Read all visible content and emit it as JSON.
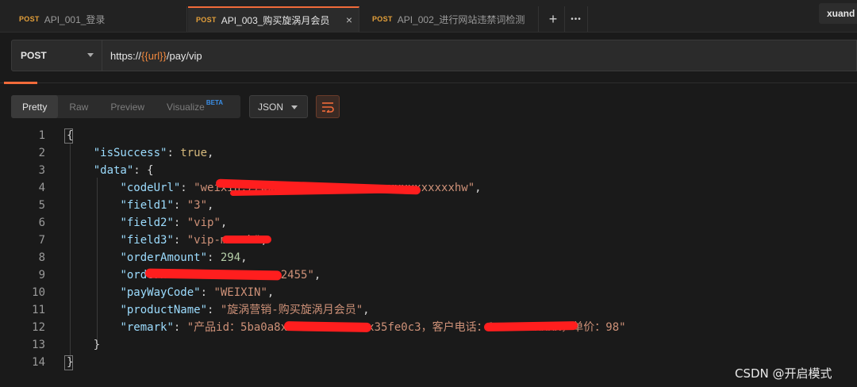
{
  "tabs": [
    {
      "method": "POST",
      "name": "API_001_登录",
      "active": false
    },
    {
      "method": "POST",
      "name": "API_003_购买旋涡月会员",
      "active": true
    },
    {
      "method": "POST",
      "name": "API_002_进行网站违禁词检测",
      "active": false
    }
  ],
  "tab_actions": {
    "new_tab": "+",
    "more": "•••",
    "close": "×"
  },
  "user_label": "xuand",
  "request": {
    "method": "POST",
    "url_prefix": "https://",
    "url_var": "{{url}}",
    "url_suffix": "/pay/vip"
  },
  "response_views": {
    "pretty": "Pretty",
    "raw": "Raw",
    "preview": "Preview",
    "visualize": "Visualize",
    "beta": "BETA",
    "format": "JSON"
  },
  "code": {
    "line_numbers": [
      "1",
      "2",
      "3",
      "4",
      "5",
      "6",
      "7",
      "8",
      "9",
      "10",
      "11",
      "12",
      "13",
      "14"
    ],
    "open_brace": "{",
    "close_brace": "}",
    "isSuccess_key": "\"isSuccess\"",
    "isSuccess_val": "true",
    "data_key": "\"data\"",
    "codeUrl_key": "\"codeUrl\"",
    "codeUrl_val": "\"weixin://wxp/u/xxxxxxxxxxxxxxxxxxxxxxxhw\"",
    "field1_key": "\"field1\"",
    "field1_val": "\"3\"",
    "field2_key": "\"field2\"",
    "field2_val": "\"vip\"",
    "field3_key": "\"field3\"",
    "field3_val": "\"vip-month\"",
    "orderAmount_key": "\"orderAmount\"",
    "orderAmount_val": "294",
    "orderNo_key": "\"orderNo\"",
    "orderNo_val": "\"xxxxxxxxxxxx2455\"",
    "payWayCode_key": "\"payWayCode\"",
    "payWayCode_val": "\"WEIXIN\"",
    "productName_key": "\"productName\"",
    "productName_val": "\"旋涡营销-购买旋涡月会员\"",
    "remark_key": "\"remark\"",
    "remark_val": "\"产品id：5ba0a8xxxxxxxxxxxxxx35fe0c3，客户电话：1xxxxxxxxxx，单价：98\"",
    "inner_close": "}"
  },
  "watermark": "CSDN @开启模式",
  "colors": {
    "accent": "#f26b3a",
    "method": "#e4a03a",
    "variable": "#f0883e",
    "beta": "#3a8ee6",
    "redaction": "#ff1e1e"
  }
}
